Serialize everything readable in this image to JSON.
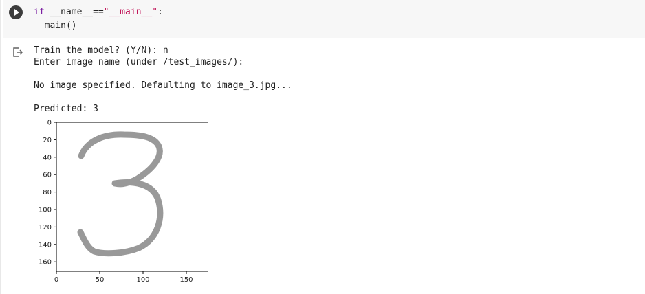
{
  "code": {
    "line1_kw": "if",
    "line1_mid": " __name__==",
    "line1_str": "\"__main__\"",
    "line1_end": ":",
    "line2": "  main()"
  },
  "output": {
    "lines": [
      "Train the model? (Y/N): n",
      "Enter image name (under /test_images/):",
      "No image specified. Defaulting to image_3.jpg...",
      "Predicted: 3"
    ]
  },
  "plot": {
    "x_ticks": [
      "0",
      "50",
      "100",
      "150"
    ],
    "y_ticks": [
      "0",
      "20",
      "40",
      "60",
      "80",
      "100",
      "120",
      "140",
      "160"
    ],
    "image_content": "handwritten-digit-3",
    "stroke_color": "#999999",
    "background_color": "#ffffff"
  },
  "icons": {
    "run": "play-icon",
    "output": "output-redirect-icon"
  }
}
